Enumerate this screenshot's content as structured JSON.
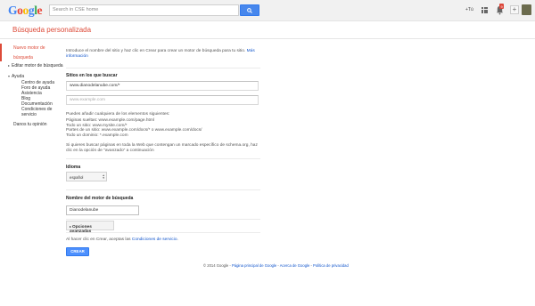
{
  "topbar": {
    "logo_letters": [
      {
        "ch": "G",
        "color": "#4285f4"
      },
      {
        "ch": "o",
        "color": "#ea4335"
      },
      {
        "ch": "o",
        "color": "#fbbc05"
      },
      {
        "ch": "g",
        "color": "#4285f4"
      },
      {
        "ch": "l",
        "color": "#34a853"
      },
      {
        "ch": "e",
        "color": "#ea4335"
      }
    ],
    "search_placeholder": "Search in CSE home",
    "plus_you": "+Tú",
    "notification_count": "9",
    "share_label": "+"
  },
  "page": {
    "title": "Búsqueda personalizada",
    "accent_color": "#dd4b39"
  },
  "sidebar": {
    "active_item_line1": "Nuevo motor de",
    "active_item_line2": "búsqueda",
    "edit": "Editar motor de búsqueda",
    "help": "Ayuda",
    "help_items": [
      "Centro de ayuda",
      "Foro de ayuda",
      "Asistencia",
      "Blog",
      "Documentación",
      "Condiciones de",
      "servicio"
    ],
    "feedback": "Danos tu opinión"
  },
  "main": {
    "intro": "Introduce el nombre del sitio y haz clic en Crear para crear un motor de búsqueda para tu sitio.",
    "intro_link_line1": "Más",
    "intro_link_line2": "información",
    "sites_heading": "Sitios en los que buscar",
    "site_value": "www.dianodelanube.com/*",
    "site_placeholder": "www.example.com",
    "examples_intro": "Puedes añadir cualquiera de los elementos siguientes:",
    "examples": [
      "Páginas sueltas: www.example.com/page.html",
      "Todo un sitio: www.mysite.com/*",
      "Partes de un sitio: www.example.com/docs/* o www.example.com/docs/",
      "Todo un dominio: *.example.com"
    ],
    "schema_line1": "Si quieres buscar páginas en toda la Web que contengan un marcado específico de schema.org, haz",
    "schema_line2": "clic en la opción de \"avanzado\" a continuación",
    "language_heading": "Idioma",
    "language_value": "español",
    "name_heading": "Nombre del motor de búsqueda",
    "name_value": "Dianodelanube",
    "advanced_label": "Opciones avanzadas",
    "terms_prefix": "Al hacer clic en Crear, aceptas las",
    "terms_link": "Condiciones de servicio",
    "terms_suffix": ".",
    "create_label": "CREAR"
  },
  "footer": {
    "copyright": "© 2014 Google",
    "sep": " - ",
    "links": [
      "Página principal de Google",
      "Acerca de Google",
      "Política de privacidad"
    ]
  }
}
